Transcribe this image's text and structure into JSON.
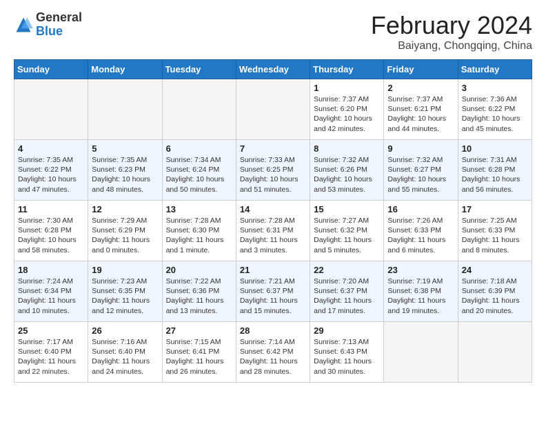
{
  "logo": {
    "general": "General",
    "blue": "Blue"
  },
  "header": {
    "title": "February 2024",
    "subtitle": "Baiyang, Chongqing, China"
  },
  "weekdays": [
    "Sunday",
    "Monday",
    "Tuesday",
    "Wednesday",
    "Thursday",
    "Friday",
    "Saturday"
  ],
  "weeks": [
    [
      {
        "day": "",
        "info": ""
      },
      {
        "day": "",
        "info": ""
      },
      {
        "day": "",
        "info": ""
      },
      {
        "day": "",
        "info": ""
      },
      {
        "day": "1",
        "info": "Sunrise: 7:37 AM\nSunset: 6:20 PM\nDaylight: 10 hours\nand 42 minutes."
      },
      {
        "day": "2",
        "info": "Sunrise: 7:37 AM\nSunset: 6:21 PM\nDaylight: 10 hours\nand 44 minutes."
      },
      {
        "day": "3",
        "info": "Sunrise: 7:36 AM\nSunset: 6:22 PM\nDaylight: 10 hours\nand 45 minutes."
      }
    ],
    [
      {
        "day": "4",
        "info": "Sunrise: 7:35 AM\nSunset: 6:22 PM\nDaylight: 10 hours\nand 47 minutes."
      },
      {
        "day": "5",
        "info": "Sunrise: 7:35 AM\nSunset: 6:23 PM\nDaylight: 10 hours\nand 48 minutes."
      },
      {
        "day": "6",
        "info": "Sunrise: 7:34 AM\nSunset: 6:24 PM\nDaylight: 10 hours\nand 50 minutes."
      },
      {
        "day": "7",
        "info": "Sunrise: 7:33 AM\nSunset: 6:25 PM\nDaylight: 10 hours\nand 51 minutes."
      },
      {
        "day": "8",
        "info": "Sunrise: 7:32 AM\nSunset: 6:26 PM\nDaylight: 10 hours\nand 53 minutes."
      },
      {
        "day": "9",
        "info": "Sunrise: 7:32 AM\nSunset: 6:27 PM\nDaylight: 10 hours\nand 55 minutes."
      },
      {
        "day": "10",
        "info": "Sunrise: 7:31 AM\nSunset: 6:28 PM\nDaylight: 10 hours\nand 56 minutes."
      }
    ],
    [
      {
        "day": "11",
        "info": "Sunrise: 7:30 AM\nSunset: 6:28 PM\nDaylight: 10 hours\nand 58 minutes."
      },
      {
        "day": "12",
        "info": "Sunrise: 7:29 AM\nSunset: 6:29 PM\nDaylight: 11 hours\nand 0 minutes."
      },
      {
        "day": "13",
        "info": "Sunrise: 7:28 AM\nSunset: 6:30 PM\nDaylight: 11 hours\nand 1 minute."
      },
      {
        "day": "14",
        "info": "Sunrise: 7:28 AM\nSunset: 6:31 PM\nDaylight: 11 hours\nand 3 minutes."
      },
      {
        "day": "15",
        "info": "Sunrise: 7:27 AM\nSunset: 6:32 PM\nDaylight: 11 hours\nand 5 minutes."
      },
      {
        "day": "16",
        "info": "Sunrise: 7:26 AM\nSunset: 6:33 PM\nDaylight: 11 hours\nand 6 minutes."
      },
      {
        "day": "17",
        "info": "Sunrise: 7:25 AM\nSunset: 6:33 PM\nDaylight: 11 hours\nand 8 minutes."
      }
    ],
    [
      {
        "day": "18",
        "info": "Sunrise: 7:24 AM\nSunset: 6:34 PM\nDaylight: 11 hours\nand 10 minutes."
      },
      {
        "day": "19",
        "info": "Sunrise: 7:23 AM\nSunset: 6:35 PM\nDaylight: 11 hours\nand 12 minutes."
      },
      {
        "day": "20",
        "info": "Sunrise: 7:22 AM\nSunset: 6:36 PM\nDaylight: 11 hours\nand 13 minutes."
      },
      {
        "day": "21",
        "info": "Sunrise: 7:21 AM\nSunset: 6:37 PM\nDaylight: 11 hours\nand 15 minutes."
      },
      {
        "day": "22",
        "info": "Sunrise: 7:20 AM\nSunset: 6:37 PM\nDaylight: 11 hours\nand 17 minutes."
      },
      {
        "day": "23",
        "info": "Sunrise: 7:19 AM\nSunset: 6:38 PM\nDaylight: 11 hours\nand 19 minutes."
      },
      {
        "day": "24",
        "info": "Sunrise: 7:18 AM\nSunset: 6:39 PM\nDaylight: 11 hours\nand 20 minutes."
      }
    ],
    [
      {
        "day": "25",
        "info": "Sunrise: 7:17 AM\nSunset: 6:40 PM\nDaylight: 11 hours\nand 22 minutes."
      },
      {
        "day": "26",
        "info": "Sunrise: 7:16 AM\nSunset: 6:40 PM\nDaylight: 11 hours\nand 24 minutes."
      },
      {
        "day": "27",
        "info": "Sunrise: 7:15 AM\nSunset: 6:41 PM\nDaylight: 11 hours\nand 26 minutes."
      },
      {
        "day": "28",
        "info": "Sunrise: 7:14 AM\nSunset: 6:42 PM\nDaylight: 11 hours\nand 28 minutes."
      },
      {
        "day": "29",
        "info": "Sunrise: 7:13 AM\nSunset: 6:43 PM\nDaylight: 11 hours\nand 30 minutes."
      },
      {
        "day": "",
        "info": ""
      },
      {
        "day": "",
        "info": ""
      }
    ]
  ]
}
